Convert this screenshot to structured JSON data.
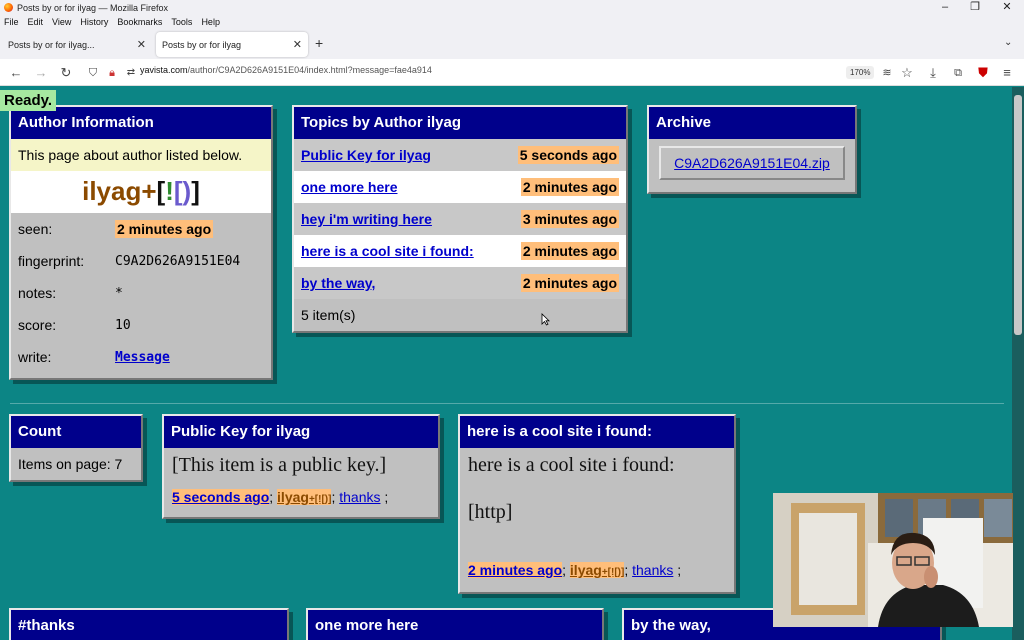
{
  "window": {
    "title": "Posts by or for ilyag — Mozilla Firefox",
    "menu": [
      "File",
      "Edit",
      "View",
      "History",
      "Bookmarks",
      "Tools",
      "Help"
    ],
    "tabs": [
      {
        "label": "Posts by or for ilyag..."
      },
      {
        "label": "Posts by or for ilyag"
      }
    ],
    "url_domain": "yavista.com",
    "url_path": "/author/C9A2D626A9151E04/index.html?message=fae4a914",
    "zoom": "170%"
  },
  "status": "Ready.",
  "author_panel": {
    "header": "Author Information",
    "intro": "This page about author listed below.",
    "name": "ilyag",
    "tag_plus": "+",
    "tag_open": "[",
    "tag_bang": "!",
    "tag_paren": "[)",
    "tag_close": "]",
    "rows": [
      {
        "label": "seen:",
        "value": "2 minutes ago"
      },
      {
        "label": "fingerprint:",
        "value": "C9A2D626A9151E04"
      },
      {
        "label": "notes:",
        "value": "*"
      },
      {
        "label": "score:",
        "value": "10"
      },
      {
        "label": "write:",
        "value": "Message"
      }
    ]
  },
  "topics_panel": {
    "header": "Topics by Author ilyag",
    "items": [
      {
        "title": "Public Key for ilyag",
        "time": "5 seconds ago"
      },
      {
        "title": "one more here",
        "time": "2 minutes ago"
      },
      {
        "title": "hey i'm writing here",
        "time": "3 minutes ago"
      },
      {
        "title": "here is a cool site i found:",
        "time": "2 minutes ago"
      },
      {
        "title": "by the way,",
        "time": "2 minutes ago"
      }
    ],
    "footer": "5 item(s)"
  },
  "archive_panel": {
    "header": "Archive",
    "file": "C9A2D626A9151E04.zip"
  },
  "count_panel": {
    "header": "Count",
    "text": "Items on page: 7"
  },
  "pubkey_panel": {
    "header": "Public Key for ilyag",
    "body": "[This item is a public key.]",
    "time": "5 seconds ago",
    "author": "ilyag",
    "tag": "+[![)]",
    "thanks": "thanks",
    "sep1": ";",
    "sep2": ";",
    "sep3": ";"
  },
  "cool_panel": {
    "header": "here is a cool site i found:",
    "body": "here is a cool site i found:",
    "body2": "[http]",
    "time": "2 minutes ago",
    "author": "ilyag",
    "tag": "+[![)]",
    "thanks": "thanks",
    "sep1": ";",
    "sep2": ";",
    "sep3": ";"
  },
  "bottom_panels": [
    {
      "header": "#thanks"
    },
    {
      "header": "one more here"
    },
    {
      "header": "by the way,"
    }
  ]
}
